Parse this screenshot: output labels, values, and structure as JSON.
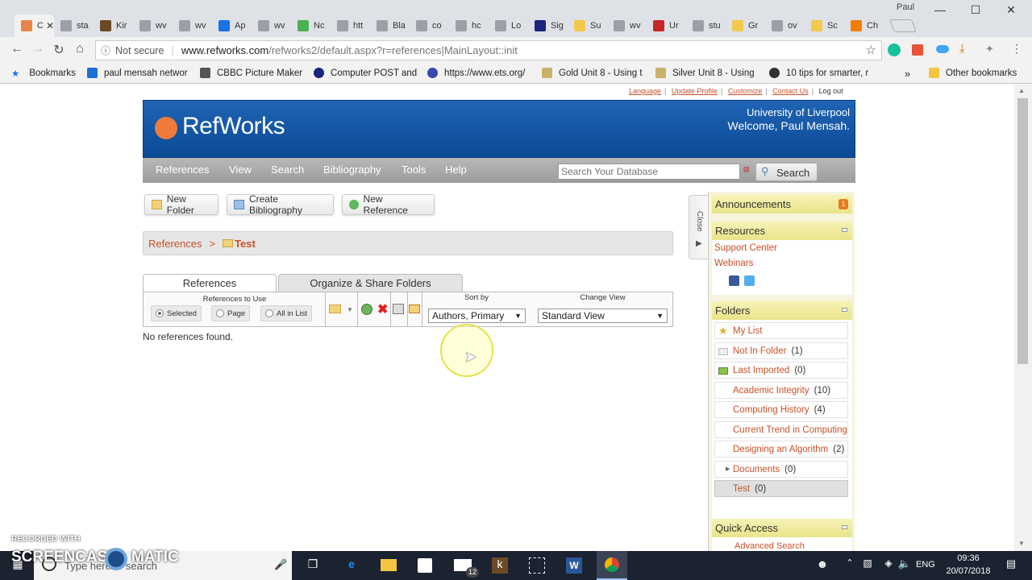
{
  "browser": {
    "tabs": [
      {
        "label": "Ci",
        "color": "#e8844a"
      },
      {
        "label": "sta",
        "color": "#9aa0a6"
      },
      {
        "label": "Kir",
        "color": "#6b4a26"
      },
      {
        "label": "wv",
        "color": "#9aa0a6"
      },
      {
        "label": "wv",
        "color": "#9aa0a6"
      },
      {
        "label": "Ap",
        "color": "#1a73e8"
      },
      {
        "label": "wv",
        "color": "#9aa0a6"
      },
      {
        "label": "Nc",
        "color": "#4caf50"
      },
      {
        "label": "htt",
        "color": "#9aa0a6"
      },
      {
        "label": "Bla",
        "color": "#9aa0a6"
      },
      {
        "label": "co",
        "color": "#9aa0a6"
      },
      {
        "label": "hc",
        "color": "#9aa0a6"
      },
      {
        "label": "Lo",
        "color": "#9aa0a6"
      },
      {
        "label": "Sig",
        "color": "#1a237e"
      },
      {
        "label": "Su",
        "color": "#f2c94c"
      },
      {
        "label": "wv",
        "color": "#9aa0a6"
      },
      {
        "label": "Ur",
        "color": "#c62828"
      },
      {
        "label": "stu",
        "color": "#9aa0a6"
      },
      {
        "label": "Gr",
        "color": "#f2c94c"
      },
      {
        "label": "ov",
        "color": "#9aa0a6"
      },
      {
        "label": "Sc",
        "color": "#f2c94c"
      },
      {
        "label": "Ch",
        "color": "#f57c00"
      }
    ],
    "user": "Paul",
    "security": "Not secure",
    "url_domain": "www.refworks.com",
    "url_path": "/refworks2/default.aspx?r=references|MainLayout::init",
    "bookmarks": [
      "Bookmarks",
      "paul mensah networ",
      "CBBC Picture Maker",
      "Computer POST and",
      "https://www.ets.org/",
      "Gold Unit 8 - Using t",
      "Silver Unit 8 - Using",
      "10 tips for smarter, r"
    ],
    "other_bookmarks": "Other bookmarks"
  },
  "refworks": {
    "top_links": [
      "Language",
      "Update Profile",
      "Customize",
      "Contact Us",
      "Log out"
    ],
    "logo": "RefWorks",
    "institution": "University of Liverpool",
    "welcome": "Welcome, Paul Mensah.",
    "nav": [
      "References",
      "View",
      "Search",
      "Bibliography",
      "Tools",
      "Help"
    ],
    "search_placeholder": "Search Your Database",
    "search_button": "Search",
    "buttons": {
      "new_folder": "New Folder",
      "create_bibliography": "Create Bibliography",
      "new_reference": "New Reference"
    },
    "breadcrumb": {
      "root": "References",
      "sep": ">",
      "current": "Test"
    },
    "tabs": {
      "references": "References",
      "organize": "Organize & Share Folders"
    },
    "refs_to_use": "References to Use",
    "radio": {
      "selected": "Selected",
      "page": "Page",
      "all": "All in List"
    },
    "sort_label": "Sort by",
    "sort_value": "Authors, Primary",
    "view_label": "Change View",
    "view_value": "Standard View",
    "empty_message": "No references found.",
    "close_label": "Close"
  },
  "sidebar": {
    "announcements": "Announcements",
    "announcement_count": "1",
    "resources": "Resources",
    "resource_links": [
      "Support Center",
      "Webinars"
    ],
    "folders_title": "Folders",
    "folders": [
      {
        "name": "My List",
        "count": ""
      },
      {
        "name": "Not In Folder",
        "count": "(1)"
      },
      {
        "name": "Last Imported",
        "count": "(0)"
      },
      {
        "name": "Academic Integrity",
        "count": "(10)"
      },
      {
        "name": "Computing History",
        "count": "(4)"
      },
      {
        "name": "Current Trend in Computing",
        "count": ""
      },
      {
        "name": "Designing an Algorithm",
        "count": "(2)"
      },
      {
        "name": "Documents",
        "count": "(0)"
      },
      {
        "name": "Test",
        "count": "(0)"
      }
    ],
    "quick_access": "Quick Access",
    "quick_first": "Advanced Search"
  },
  "taskbar": {
    "search_placeholder": "Type here to search",
    "mail_badge": "12",
    "lang": "ENG",
    "time": "09:36",
    "date": "20/07/2018"
  },
  "watermark": {
    "line1": "RECORDED WITH",
    "line2": "SCREENCAST",
    "line3": "MATIC"
  }
}
